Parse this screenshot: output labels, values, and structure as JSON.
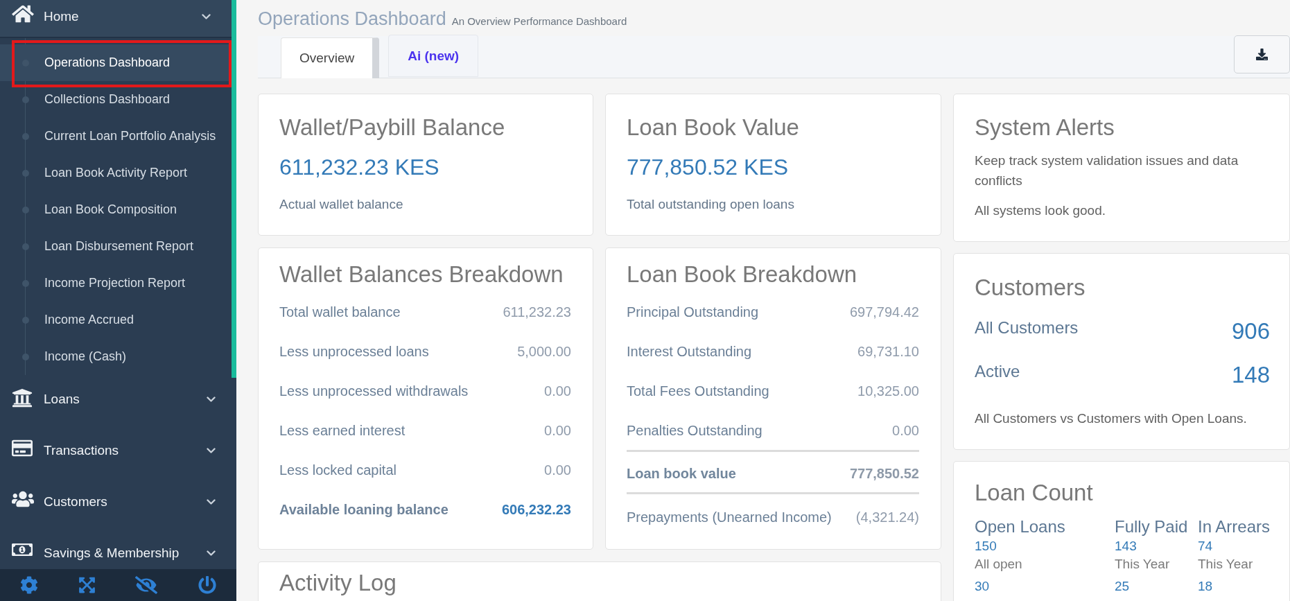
{
  "sidebar": {
    "menu": [
      {
        "label": "Home",
        "expanded": true,
        "children": [
          {
            "label": "Operations Dashboard",
            "selected": true,
            "outlined": true
          },
          {
            "label": "Collections Dashboard",
            "selected": false,
            "outlined": false
          },
          {
            "label": "Current Loan Portfolio Analysis",
            "selected": false,
            "outlined": false
          },
          {
            "label": "Loan Book Activity Report",
            "selected": false,
            "outlined": false
          },
          {
            "label": "Loan Book Composition",
            "selected": false,
            "outlined": false
          },
          {
            "label": "Loan Disbursement Report",
            "selected": false,
            "outlined": false
          },
          {
            "label": "Income Projection Report",
            "selected": false,
            "outlined": false
          },
          {
            "label": "Income Accrued",
            "selected": false,
            "outlined": false
          },
          {
            "label": "Income (Cash)",
            "selected": false,
            "outlined": false
          }
        ]
      },
      {
        "label": "Loans",
        "expanded": false
      },
      {
        "label": "Transactions",
        "expanded": false
      },
      {
        "label": "Customers",
        "expanded": false
      },
      {
        "label": "Savings & Membership",
        "expanded": false
      }
    ]
  },
  "page_header": {
    "title": "Operations Dashboard",
    "subtitle": "An Overview Performance Dashboard"
  },
  "tabs": [
    {
      "label": "Overview",
      "selected": true,
      "kind": "standard"
    },
    {
      "label": "Ai (new)",
      "selected": false,
      "kind": "new"
    }
  ],
  "summary_cards": [
    {
      "title": "Wallet/Paybill Balance",
      "value": "611,232.23 KES",
      "caption": "Actual wallet balance"
    },
    {
      "title": "Loan Book Value",
      "value": "777,850.52 KES",
      "caption": "Total outstanding open loans"
    }
  ],
  "breakdowns": [
    {
      "title": "Wallet Balances Breakdown",
      "rows": [
        {
          "kind": "line",
          "label": "Total wallet balance",
          "value": "611,232.23"
        },
        {
          "kind": "line",
          "label": "Less unprocessed loans",
          "value": "5,000.00"
        },
        {
          "kind": "line",
          "label": "Less unprocessed withdrawals",
          "value": "0.00"
        },
        {
          "kind": "line",
          "label": "Less earned interest",
          "value": "0.00"
        },
        {
          "kind": "line",
          "label": "Less locked capital",
          "value": "0.00"
        },
        {
          "kind": "total",
          "label": "Available loaning balance",
          "value": "606,232.23"
        }
      ]
    },
    {
      "title": "Loan Book Breakdown",
      "rows": [
        {
          "kind": "line",
          "label": "Principal Outstanding",
          "value": "697,794.42"
        },
        {
          "kind": "line",
          "label": "Interest Outstanding",
          "value": "69,731.10"
        },
        {
          "kind": "line",
          "label": "Total Fees Outstanding",
          "value": "10,325.00"
        },
        {
          "kind": "line",
          "label": "Penalties Outstanding",
          "value": "0.00"
        },
        {
          "kind": "rule"
        },
        {
          "kind": "subtotal",
          "label": "Loan book value",
          "value": "777,850.52"
        },
        {
          "kind": "rule"
        },
        {
          "kind": "line",
          "label": "Prepayments (Unearned Income)",
          "value": "(4,321.24)"
        }
      ]
    }
  ],
  "activity_log": {
    "title": "Activity Log"
  },
  "system_alerts": {
    "title": "System Alerts",
    "description": "Keep track system validation issues and data conflicts",
    "status": "All systems look good."
  },
  "customers": {
    "title": "Customers",
    "stats": [
      {
        "label": "All Customers",
        "value": "906"
      },
      {
        "label": "Active",
        "value": "148"
      }
    ],
    "note": "All Customers vs Customers with Open Loans."
  },
  "loan_count": {
    "title": "Loan Count",
    "columns": [
      {
        "heading": "Open Loans",
        "entries": [
          {
            "value": "150",
            "caption": "All open"
          },
          {
            "value": "30"
          }
        ]
      },
      {
        "heading": "Fully Paid",
        "entries": [
          {
            "value": "143",
            "caption": "This Year"
          },
          {
            "value": "25"
          }
        ]
      },
      {
        "heading": "In Arrears",
        "entries": [
          {
            "value": "74",
            "caption": "This Year"
          },
          {
            "value": "18"
          }
        ]
      }
    ]
  }
}
